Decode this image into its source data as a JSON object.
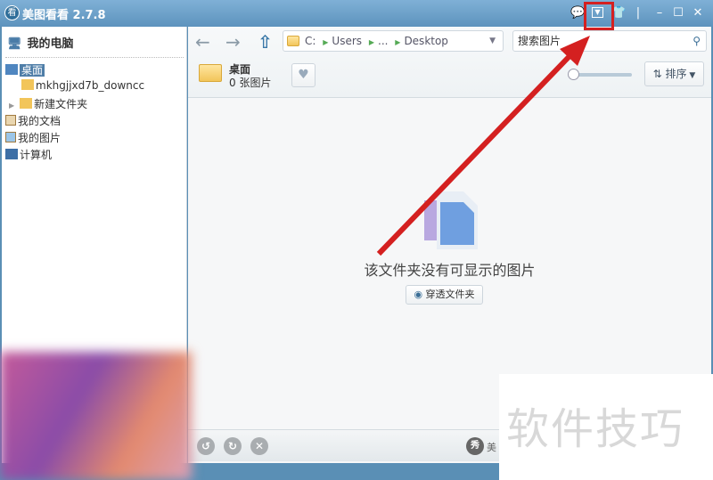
{
  "window": {
    "title": "美图看看 2.7.8",
    "logo_text": "看"
  },
  "titlebar_icons": [
    "comment-icon",
    "dropdown-menu-icon",
    "skin-icon",
    "minimize-icon",
    "maximize-icon",
    "close-icon"
  ],
  "sidebar": {
    "header": "我的电脑",
    "items": [
      {
        "label": "桌面",
        "selected": true
      },
      {
        "label": "mkhgjjxd7b_downcc"
      },
      {
        "label": "新建文件夹"
      },
      {
        "label": "我的文档"
      },
      {
        "label": "我的图片"
      },
      {
        "label": "计算机"
      }
    ]
  },
  "address": {
    "segments": [
      "C:",
      "Users",
      "...",
      "Desktop"
    ]
  },
  "search": {
    "placeholder": "搜索图片"
  },
  "folder": {
    "name": "桌面",
    "count": "0 张图片"
  },
  "sort_label": "排序",
  "empty": {
    "message": "该文件夹没有可显示的图片",
    "button": "穿透文件夹"
  },
  "status": {
    "brand_icon": "秀",
    "brand_text": "美"
  },
  "watermark": "软件技巧",
  "colors": {
    "titlebar": "#6a9dc4",
    "selection": "#4f7ea8",
    "annotation": "#d42020"
  }
}
